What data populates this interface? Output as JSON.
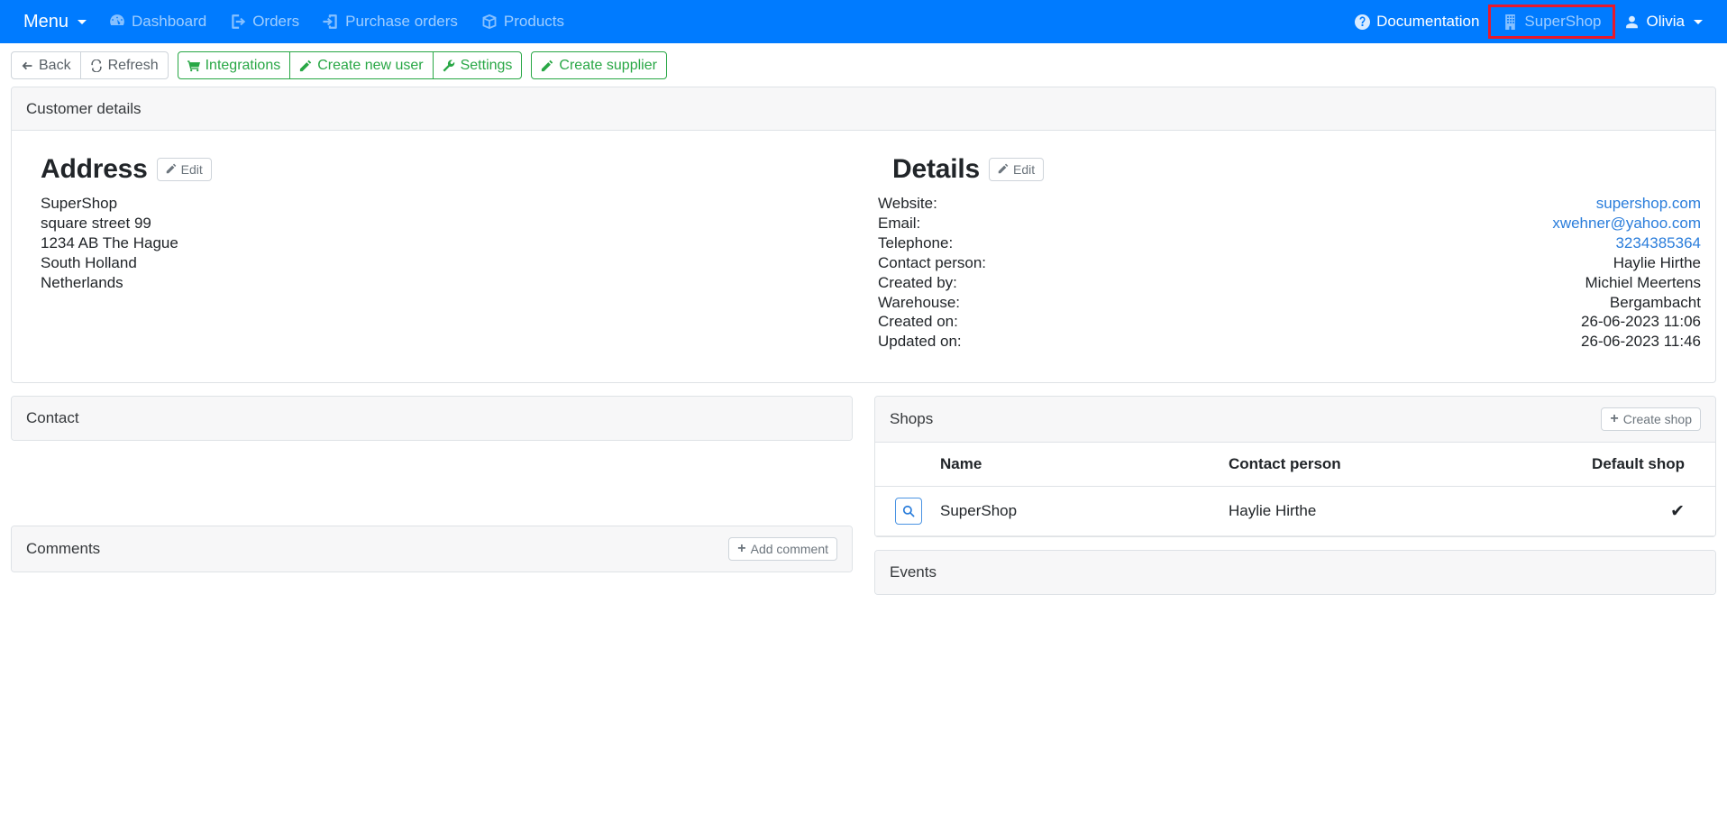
{
  "navbar": {
    "brand": "Menu",
    "items": [
      {
        "label": "Dashboard",
        "icon": "dashboard-icon"
      },
      {
        "label": "Orders",
        "icon": "orders-icon"
      },
      {
        "label": "Purchase orders",
        "icon": "purchase-orders-icon"
      },
      {
        "label": "Products",
        "icon": "products-icon"
      }
    ],
    "right": [
      {
        "label": "Documentation",
        "icon": "help-circle-icon"
      },
      {
        "label": "SuperShop",
        "icon": "building-icon"
      },
      {
        "label": "Olivia",
        "icon": "user-icon"
      }
    ],
    "brand_color": "#007bff",
    "highlight_color": "#e8192c",
    "highlighted_item": "SuperShop"
  },
  "toolbar": {
    "back": "Back",
    "refresh": "Refresh",
    "integrations": "Integrations",
    "create_new_user": "Create new user",
    "settings": "Settings",
    "create_supplier": "Create supplier"
  },
  "customer_details": {
    "header": "Customer details",
    "address": {
      "title": "Address",
      "edit_label": "Edit",
      "lines": [
        "SuperShop",
        "square street 99",
        "1234 AB The Hague",
        "South Holland",
        "Netherlands"
      ]
    },
    "details": {
      "title": "Details",
      "edit_label": "Edit",
      "rows": [
        {
          "label": "Website:",
          "value": "supershop.com",
          "link": true
        },
        {
          "label": "Email:",
          "value": "xwehner@yahoo.com",
          "link": true
        },
        {
          "label": "Telephone:",
          "value": "3234385364",
          "link": true
        },
        {
          "label": "Contact person:",
          "value": "Haylie Hirthe",
          "link": false
        },
        {
          "label": "Created by:",
          "value": "Michiel Meertens",
          "link": false
        },
        {
          "label": "Warehouse:",
          "value": "Bergambacht",
          "link": false
        },
        {
          "label": "Created on:",
          "value": "26-06-2023 11:06",
          "link": false
        },
        {
          "label": "Updated on:",
          "value": "26-06-2023 11:46",
          "link": false
        }
      ]
    }
  },
  "contact": {
    "header": "Contact"
  },
  "comments": {
    "header": "Comments",
    "add_label": "Add comment"
  },
  "shops": {
    "header": "Shops",
    "create_label": "Create shop",
    "columns": [
      "",
      "Name",
      "Contact person",
      "Default shop"
    ],
    "rows": [
      {
        "action_icon": "search-icon",
        "name": "SuperShop",
        "contact_person": "Haylie Hirthe",
        "default_shop": "✔"
      }
    ]
  },
  "events": {
    "header": "Events"
  }
}
